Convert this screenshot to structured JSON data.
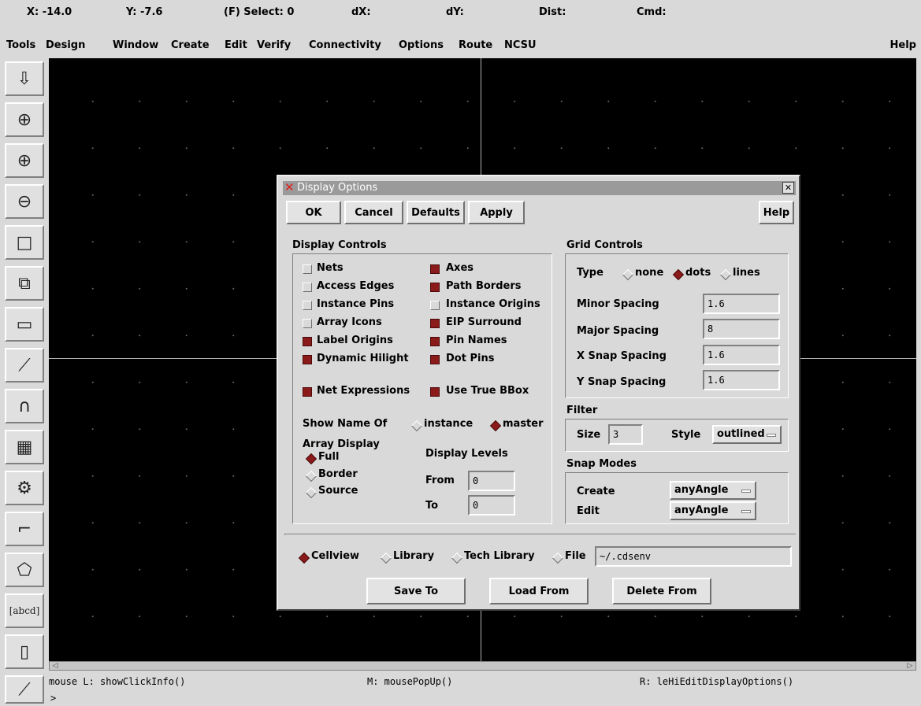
{
  "status": {
    "x": "X: -14.0",
    "y": "Y: -7.6",
    "select": "(F) Select: 0",
    "dx": "dX:",
    "dy": "dY:",
    "dist": "Dist:",
    "cmd": "Cmd:"
  },
  "menubar": {
    "items": [
      "Tools",
      "Design",
      "Window",
      "Create",
      "Edit",
      "Verify",
      "Connectivity",
      "Options",
      "Route",
      "NCSU"
    ],
    "help": "Help"
  },
  "toolbar": {
    "icons": [
      "save-icon",
      "zoom-fit-icon",
      "zoom-in-icon",
      "zoom-out-icon",
      "stretch-icon",
      "copy-icon",
      "move-icon",
      "wire-icon",
      "arc-icon",
      "instance-icon",
      "pin-icon",
      "path-icon",
      "polygon-icon",
      "label-icon",
      "rectangle-icon",
      "ruler-icon"
    ],
    "label_button": "[abcd]"
  },
  "dialog": {
    "title": "Display Options",
    "buttons": {
      "ok": "OK",
      "cancel": "Cancel",
      "defaults": "Defaults",
      "apply": "Apply",
      "help": "Help"
    },
    "display_controls": {
      "heading": "Display Controls",
      "left": [
        {
          "label": "Nets",
          "checked": false
        },
        {
          "label": "Access Edges",
          "checked": false
        },
        {
          "label": "Instance Pins",
          "checked": false
        },
        {
          "label": "Array Icons",
          "checked": false
        },
        {
          "label": "Label Origins",
          "checked": true
        },
        {
          "label": "Dynamic Hilight",
          "checked": true
        }
      ],
      "right": [
        {
          "label": "Axes",
          "checked": true
        },
        {
          "label": "Path Borders",
          "checked": true
        },
        {
          "label": "Instance Origins",
          "checked": false
        },
        {
          "label": "EIP Surround",
          "checked": true
        },
        {
          "label": "Pin Names",
          "checked": true
        },
        {
          "label": "Dot Pins",
          "checked": true
        }
      ],
      "net_expressions": {
        "label": "Net Expressions",
        "checked": true
      },
      "use_true_bbox": {
        "label": "Use True BBox",
        "checked": true
      },
      "show_name_of": {
        "label": "Show Name Of",
        "options": [
          "instance",
          "master"
        ],
        "selected": "master"
      },
      "array_display": {
        "label": "Array Display",
        "options": [
          "Full",
          "Border",
          "Source"
        ],
        "selected": "Full"
      },
      "display_levels": {
        "label": "Display Levels",
        "from_label": "From",
        "from_value": "0",
        "to_label": "To",
        "to_value": "0"
      }
    },
    "grid_controls": {
      "heading": "Grid Controls",
      "type_label": "Type",
      "type_options": [
        "none",
        "dots",
        "lines"
      ],
      "type_selected": "dots",
      "minor_spacing": {
        "label": "Minor Spacing",
        "value": "1.6"
      },
      "major_spacing": {
        "label": "Major Spacing",
        "value": "8"
      },
      "x_snap_spacing": {
        "label": "X Snap Spacing",
        "value": "1.6"
      },
      "y_snap_spacing": {
        "label": "Y Snap Spacing",
        "value": "1.6"
      }
    },
    "filter": {
      "heading": "Filter",
      "size_label": "Size",
      "size_value": "3",
      "style_label": "Style",
      "style_value": "outlined"
    },
    "snap_modes": {
      "heading": "Snap Modes",
      "create_label": "Create",
      "create_value": "anyAngle",
      "edit_label": "Edit",
      "edit_value": "anyAngle"
    },
    "source": {
      "options": [
        "Cellview",
        "Library",
        "Tech Library",
        "File"
      ],
      "selected": "Cellview",
      "file_value": "~/.cdsenv"
    },
    "actions": {
      "save_to": "Save To",
      "load_from": "Load From",
      "delete_from": "Delete From"
    }
  },
  "mouse": {
    "left": "mouse L: showClickInfo()",
    "middle": "M: mousePopUp()",
    "right": "R: leHiEditDisplayOptions()"
  },
  "prompt": ">"
}
